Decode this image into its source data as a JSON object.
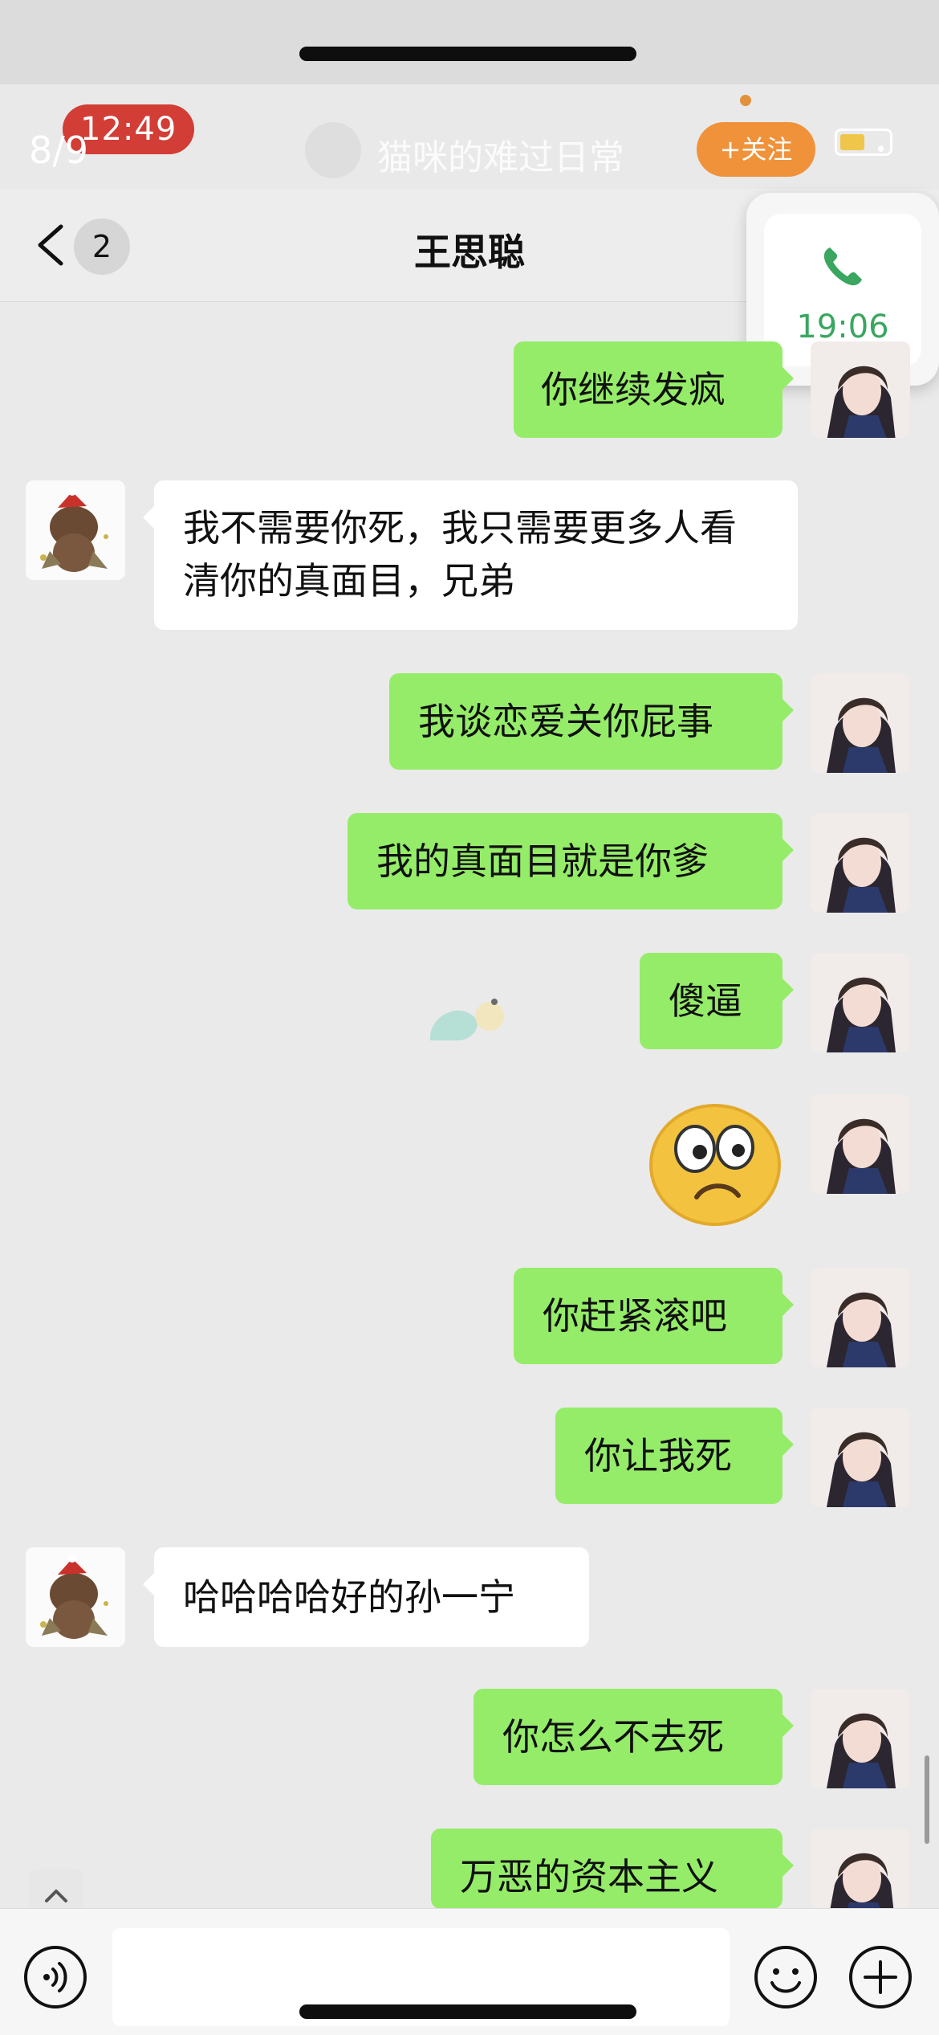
{
  "story_overlay": {
    "page_counter": "8/9",
    "time_badge": "12:49",
    "account_name": "猫咪的难过日常",
    "follow_label": "+关注"
  },
  "chat": {
    "unread_count": "2",
    "title": "王思聪",
    "call_widget_time": "19:06"
  },
  "messages": [
    {
      "side": "me",
      "text": "你继续发疯"
    },
    {
      "side": "them",
      "text": "我不需要你死，我只需要更多人看清你的真面目，兄弟"
    },
    {
      "side": "me",
      "text": "我谈恋爱关你屁事"
    },
    {
      "side": "me",
      "text": "我的真面目就是你爹"
    },
    {
      "side": "me",
      "text": "傻逼"
    },
    {
      "side": "me",
      "type": "sticker",
      "icon": "worried-face-emoji"
    },
    {
      "side": "me",
      "text": "你赶紧滚吧"
    },
    {
      "side": "me",
      "text": "你让我死"
    },
    {
      "side": "them",
      "text": "哈哈哈哈好的孙一宁"
    },
    {
      "side": "me",
      "text": "你怎么不去死"
    },
    {
      "side": "me",
      "text": "万恶的资本主义"
    }
  ],
  "input_bar": {
    "icons": [
      "voice-icon",
      "smile-icon",
      "plus-icon"
    ]
  },
  "colors": {
    "my_bubble": "#95ec69",
    "their_bubble": "#ffffff",
    "background": "#eaeaea",
    "follow_button": "#f0923a",
    "time_badge": "#d23d36",
    "call_green": "#3aa660"
  }
}
